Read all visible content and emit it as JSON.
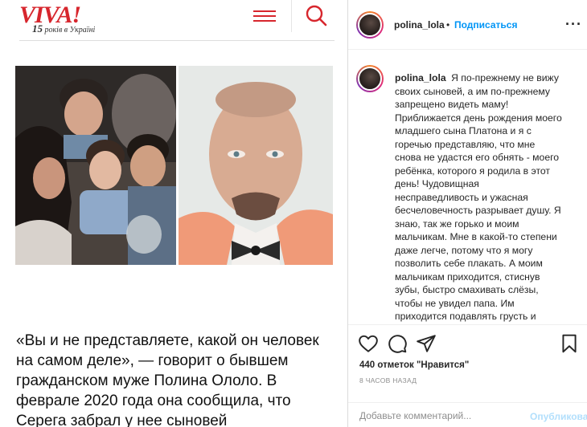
{
  "article": {
    "logo": "VIVA!",
    "tagline_number": "15",
    "tagline_text": "років в Україні",
    "quote": "«Вы и не представляете, какой он человек на самом деле», — говорит о бывшем гражданском муже Полина Ололо. В феврале 2020 года она сообщила, что Серега забрал у нее сыновей"
  },
  "instagram": {
    "header": {
      "username": "polina_lola",
      "separator": "•",
      "follow_label": "Подписаться",
      "more_label": "···"
    },
    "caption": {
      "username": "polina_lola",
      "text": "Я по-прежнему не вижу своих сыновей, а им по-прежнему запрещено видеть маму! Приближается день рождения моего младшего сына Платона и я с горечью представляю, что мне снова не удастся его обнять - моего ребёнка, которого я родила в этот день! Чудовищная несправедливость и ужасная бесчеловечность разрывает душу. Я знаю, так же горько и моим мальчикам. Мне в какой-то степени даже легче, потому что я могу позволить себе плакать. А моим мальчикам приходится, стиснув зубы, быстро смахивать слёзы, чтобы не увидел папа. Им приходится подавлять грусть и отчаяние, им приходится верить, в"
    },
    "likes": "440 отметок \"Нравится\"",
    "time": "8 ЧАСОВ НАЗАД",
    "comment_placeholder": "Добавьте комментарий...",
    "publish_label": "Опубликовать"
  },
  "colors": {
    "viva_red": "#d7262d",
    "ig_blue": "#0095f6",
    "ig_publish_disabled": "#b2dffc"
  },
  "icons": [
    "menu-icon",
    "search-icon",
    "heart-icon",
    "comment-icon",
    "share-icon",
    "bookmark-icon",
    "more-icon"
  ]
}
